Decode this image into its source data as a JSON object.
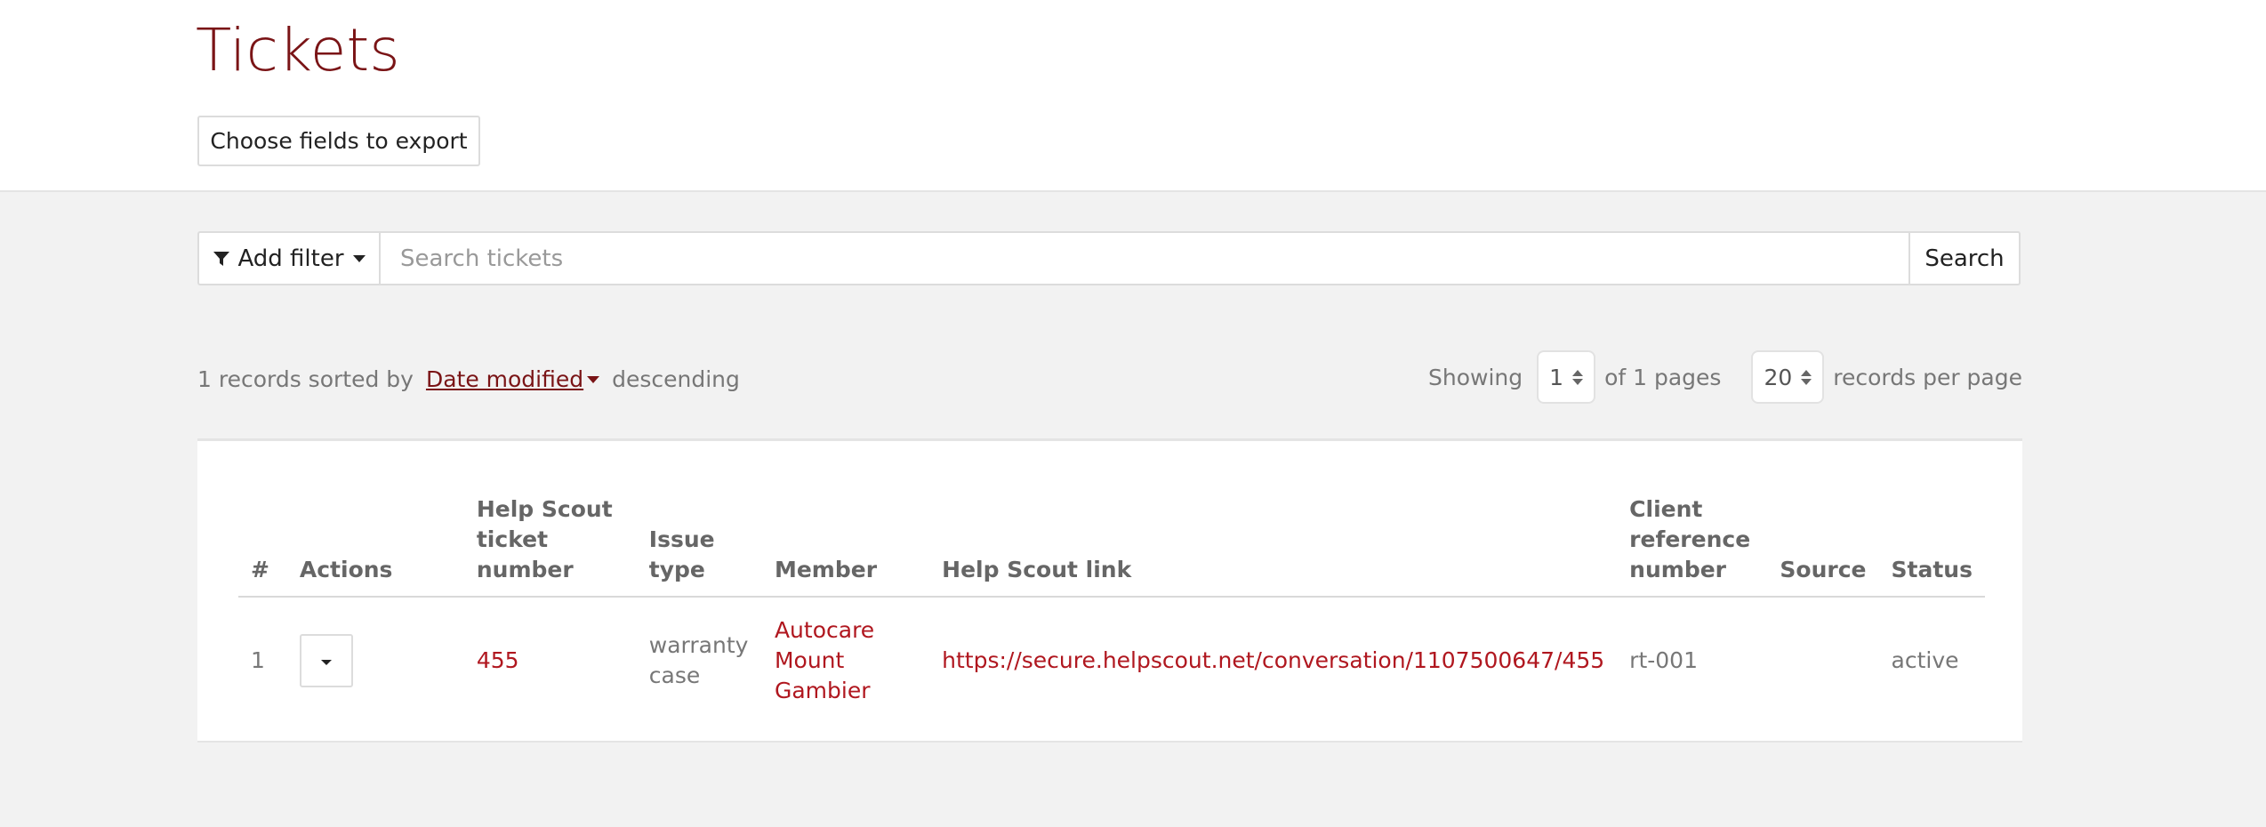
{
  "page": {
    "title": "Tickets"
  },
  "toolbar": {
    "export_label": "Choose fields to export"
  },
  "search": {
    "filter_label": "Add filter",
    "placeholder": "Search tickets",
    "value": "",
    "button_label": "Search"
  },
  "sort": {
    "prefix": "1 records sorted by",
    "field": "Date modified",
    "direction": "descending"
  },
  "pagination": {
    "showing_label": "Showing",
    "current_page": "1",
    "of_pages_label": "of 1 pages",
    "per_page": "20",
    "per_page_label": "records per page"
  },
  "table": {
    "columns": [
      {
        "line1": "#",
        "line2": "",
        "line3": ""
      },
      {
        "line1": "Actions",
        "line2": "",
        "line3": ""
      },
      {
        "line1": "Help Scout",
        "line2": "ticket number",
        "line3": ""
      },
      {
        "line1": "Issue",
        "line2": "type",
        "line3": ""
      },
      {
        "line1": "Member",
        "line2": "",
        "line3": ""
      },
      {
        "line1": "Help Scout link",
        "line2": "",
        "line3": ""
      },
      {
        "line1": "Client",
        "line2": "reference",
        "line3": "number"
      },
      {
        "line1": "Source",
        "line2": "",
        "line3": ""
      },
      {
        "line1": "Status",
        "line2": "",
        "line3": ""
      }
    ],
    "rows": [
      {
        "num": "1",
        "ticket_number": "455",
        "issue_type_line1": "warranty",
        "issue_type_line2": "case",
        "member_line1": "Autocare",
        "member_line2": "Mount Gambier",
        "link": "https://secure.helpscout.net/conversation/1107500647/455",
        "client_reference": "rt-001",
        "source": "",
        "status": "active"
      }
    ]
  },
  "colors": {
    "brand": "#7a1416",
    "link": "#b0171f",
    "background": "#f2f2f2"
  },
  "icons": {
    "filter": "funnel-icon",
    "dropdown": "caret-down-icon",
    "spinner": "up-down-arrows-icon"
  }
}
